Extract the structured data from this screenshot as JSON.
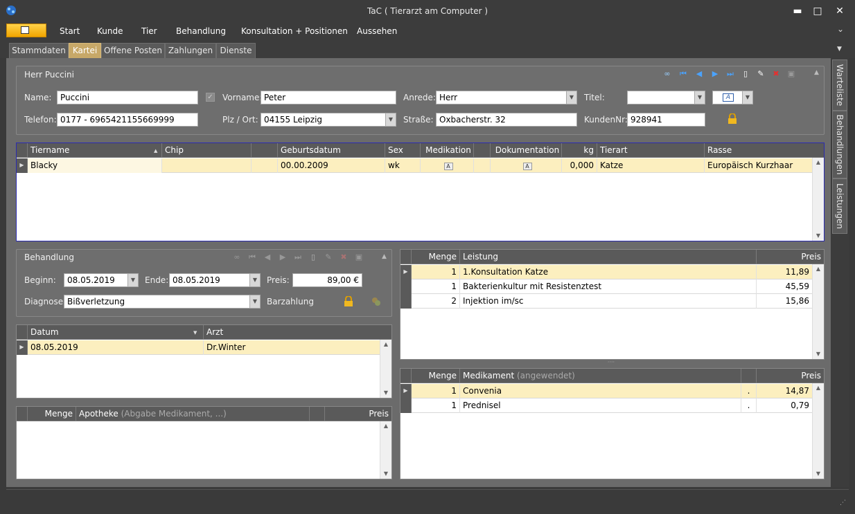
{
  "window": {
    "title": "TaC ( Tierarzt am Computer )",
    "minimize": "▬",
    "maximize": "□",
    "close": "✕",
    "expand": "⌄"
  },
  "menu": {
    "items": [
      "Start",
      "Kunde",
      "Tier",
      "Behandlung",
      "Konsultation + Positionen",
      "Aussehen"
    ]
  },
  "tabs": [
    {
      "label": "Stammdaten",
      "active": false
    },
    {
      "label": "Kartei",
      "active": true
    },
    {
      "label": "Offene Posten",
      "active": false
    },
    {
      "label": "Zahlungen",
      "active": false
    },
    {
      "label": "Dienste",
      "active": false
    }
  ],
  "sidebar": {
    "items": [
      "Warteliste",
      "Behandlungen",
      "Leistungen"
    ]
  },
  "customer": {
    "header": "Herr  Puccini",
    "name_label": "Name:",
    "name_value": "Puccini",
    "vorname_label": "Vorname:",
    "vorname_value": "Peter",
    "anrede_label": "Anrede:",
    "anrede_value": "Herr",
    "titel_label": "Titel:",
    "titel_value": "",
    "telefon_label": "Telefon:",
    "telefon_value": "0177 - 6965421155669999",
    "plz_label": "Plz / Ort:",
    "plz_value": "04155  Leipzig",
    "strasse_label": "Straße:",
    "strasse_value": "Oxbacherstr. 32",
    "kundennr_label": "KundenNr:",
    "kundennr_value": "928941"
  },
  "animals": {
    "columns": [
      "Tiername",
      "Chip",
      "",
      "Geburtsdatum",
      "Sex",
      "Medikation",
      "",
      "Dokumentation",
      "kg",
      "Tierart",
      "Rasse"
    ],
    "rows": [
      {
        "tiername": "Blacky",
        "chip": "",
        "extra": "",
        "geburtsdatum": "00.00.2009",
        "sex": "wk",
        "medikation": "A",
        "extra2": "",
        "dokumentation": "A",
        "kg": "0,000",
        "tierart": "Katze",
        "rasse": "Europäisch Kurzhaar"
      }
    ]
  },
  "treatment": {
    "title": "Behandlung",
    "beginn_label": "Beginn:",
    "beginn_value": "08.05.2019",
    "ende_label": "Ende:",
    "ende_value": "08.05.2019",
    "preis_label": "Preis:",
    "preis_value": "89,00 €",
    "diagnose_label": "Diagnose:",
    "diagnose_value": "Bißverletzung",
    "barzahlung_label": "Barzahlung"
  },
  "dates": {
    "columns": [
      "Datum",
      "Arzt"
    ],
    "rows": [
      {
        "datum": "08.05.2019",
        "arzt": "Dr.Winter"
      }
    ]
  },
  "pharmacy": {
    "columns": {
      "menge": "Menge",
      "apotheke": "Apotheke",
      "apotheke_hint": "(Abgabe Medikament, ...)",
      "preis": "Preis"
    }
  },
  "services": {
    "columns": {
      "menge": "Menge",
      "leistung": "Leistung",
      "preis": "Preis"
    },
    "rows": [
      {
        "menge": "1",
        "leistung": "1.Konsultation Katze",
        "preis": "11,89"
      },
      {
        "menge": "1",
        "leistung": "Bakterienkultur mit Resistenztest",
        "preis": "45,59"
      },
      {
        "menge": "2",
        "leistung": "Injektion im/sc",
        "preis": "15,86"
      }
    ]
  },
  "medications": {
    "columns": {
      "menge": "Menge",
      "medikament": "Medikament",
      "medikament_hint": "(angewendet)",
      "preis": "Preis"
    },
    "rows": [
      {
        "menge": "1",
        "medikament": "Convenia",
        "dot": ".",
        "preis": "14,87"
      },
      {
        "menge": "1",
        "medikament": "Prednisel",
        "dot": ".",
        "preis": "0,79"
      }
    ]
  }
}
